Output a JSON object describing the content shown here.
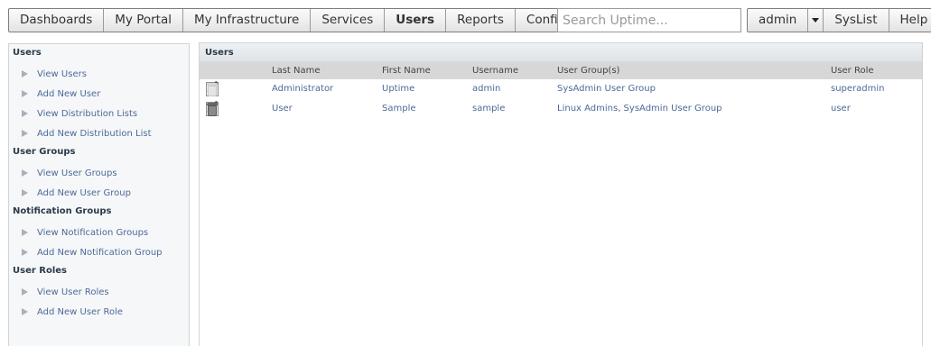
{
  "nav": {
    "tabs": [
      {
        "label": "Dashboards"
      },
      {
        "label": "My Portal"
      },
      {
        "label": "My Infrastructure"
      },
      {
        "label": "Services"
      },
      {
        "label": "Users",
        "active": true
      },
      {
        "label": "Reports"
      },
      {
        "label": "Config"
      }
    ],
    "search_placeholder": "Search Uptime...",
    "user_label": "admin",
    "syslist_label": "SysList",
    "help_label": "Help"
  },
  "sidebar": {
    "sections": [
      {
        "title": "Users",
        "links": [
          "View Users",
          "Add New User",
          "View Distribution Lists",
          "Add New Distribution List"
        ]
      },
      {
        "title": "User Groups",
        "links": [
          "View User Groups",
          "Add New User Group"
        ]
      },
      {
        "title": "Notification Groups",
        "links": [
          "View Notification Groups",
          "Add New Notification Group"
        ]
      },
      {
        "title": "User Roles",
        "links": [
          "View User Roles",
          "Add New User Role"
        ]
      }
    ]
  },
  "main": {
    "title": "Users",
    "columns": {
      "last_name": "Last Name",
      "first_name": "First Name",
      "username": "Username",
      "user_groups": "User Group(s)",
      "user_role": "User Role"
    },
    "rows": [
      {
        "last_name": "Administrator",
        "first_name": "Uptime",
        "username": "admin",
        "user_groups": "SysAdmin User Group",
        "user_role": "superadmin",
        "delete_enabled": false
      },
      {
        "last_name": "User",
        "first_name": "Sample",
        "username": "sample",
        "user_groups": "Linux Admins, SysAdmin User Group",
        "user_role": "user",
        "delete_enabled": true
      }
    ]
  },
  "icons": {
    "view": "view-document-icon",
    "edit": "edit-pencil-icon",
    "delete": "trash-icon",
    "link_bullet": "triangle-right-icon",
    "dropdown": "chevron-down-icon"
  },
  "colors": {
    "link": "#4c6a9a",
    "header_bg": "#d7d7d7",
    "sidebar_bg": "#f6f7f8"
  }
}
